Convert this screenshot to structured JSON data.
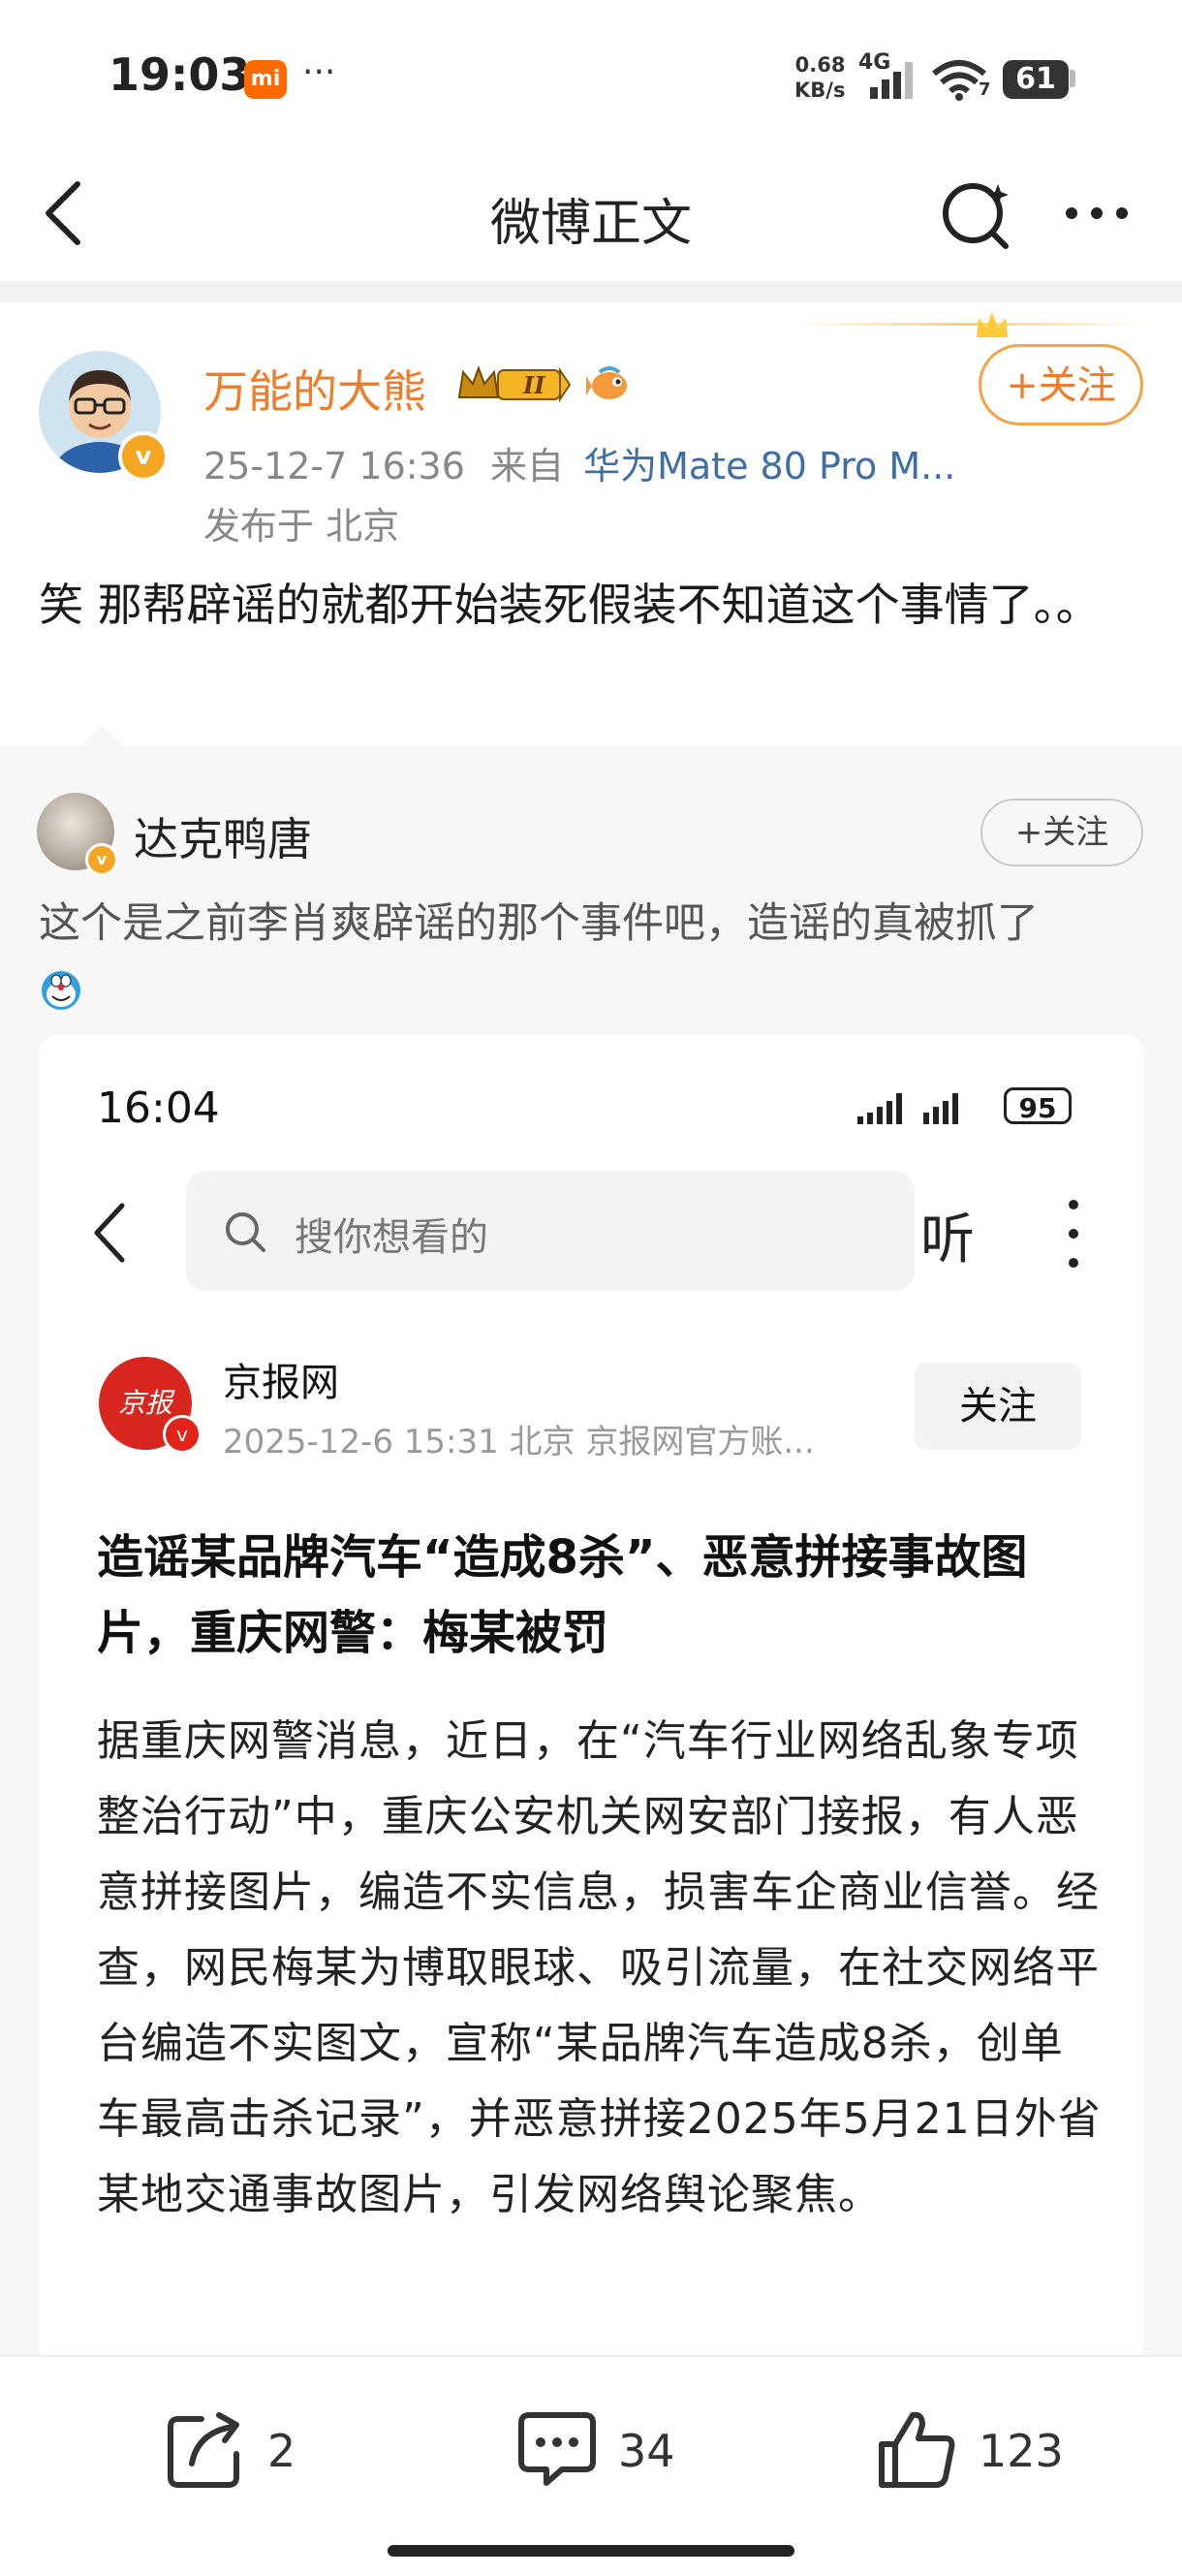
{
  "status_bar": {
    "time": "19:03",
    "mi_badge": "mi",
    "dots": "···",
    "net_speed_value": "0.68",
    "net_speed_unit": "KB/s",
    "network": "4G",
    "wifi_level": "7",
    "battery": "61"
  },
  "nav": {
    "title": "微博正文"
  },
  "post": {
    "author_name": "万能的大熊",
    "member_badge": "II",
    "follow_label": "+关注",
    "date": "25-12-7 16:36",
    "from_label": "来自",
    "device": "华为Mate 80 Pro M...",
    "location": "发布于 北京",
    "text": "笑 那帮辟谣的就都开始装死假装不知道这个事情了。。"
  },
  "retweet": {
    "author_name": "达克鸭唐",
    "follow_label": "+关注",
    "text": "这个是之前李肖爽辟谣的那个事件吧，造谣的真被抓了",
    "card": {
      "time": "16:04",
      "battery": "95",
      "search_placeholder": "搜你想看的",
      "listen_label": "听",
      "source_logo": "京报",
      "source_name": "京报网",
      "source_meta": "2025-12-6  15:31  北京  京报网官方账...",
      "follow_label": "关注",
      "headline": "造谣某品牌汽车“造成8杀”、恶意拼接事故图片，重庆网警：梅某被罚",
      "body": "据重庆网警消息，近日，在“汽车行业网络乱象专项整治行动”中，重庆公安机关网安部门接报，有人恶意拼接图片，编造不实信息，损害车企商业信誉。经查，网民梅某为博取眼球、吸引流量，在社交网络平台编造不实图文，宣称“某品牌汽车造成8杀，创单车最高击杀记录”，并恶意拼接2025年5月21日外省某地交通事故图片，引发网络舆论聚焦。"
    }
  },
  "actions": {
    "repost_count": "2",
    "comment_count": "34",
    "like_count": "123"
  },
  "colors": {
    "author_name": "#f07c2a",
    "device_link": "#3f6ea6",
    "follow_border": "#f4a347"
  }
}
